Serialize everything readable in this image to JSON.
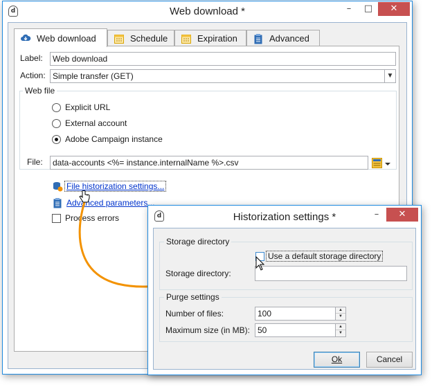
{
  "main_window": {
    "title": "Web download *",
    "app_icon_glyph": "d",
    "minimize": "–",
    "maximize": "□",
    "close": "✕",
    "tabs": [
      {
        "label": "Web download",
        "icon": "cloud-download-icon",
        "active": true
      },
      {
        "label": "Schedule",
        "icon": "calendar-icon",
        "active": false
      },
      {
        "label": "Expiration",
        "icon": "calendar-icon",
        "active": false
      },
      {
        "label": "Advanced",
        "icon": "clipboard-icon",
        "active": false
      }
    ],
    "label_caption": "Label:",
    "label_value": "Web download",
    "action_caption": "Action:",
    "action_value": "Simple transfer (GET)",
    "web_file_group": "Web file",
    "radio_explicit_url": "Explicit URL",
    "radio_external_account": "External account",
    "radio_adobe_instance": "Adobe Campaign instance",
    "selected_radio": "Adobe Campaign instance",
    "file_caption": "File:",
    "file_value": "data-accounts <%= instance.internalName %>.csv",
    "link_historization": "File historization settings...",
    "link_advanced": "Advanced parameters...",
    "process_errors": "Process errors",
    "process_errors_checked": false
  },
  "dialog": {
    "title": "Historization settings *",
    "app_icon_glyph": "d",
    "minimize": "–",
    "close": "✕",
    "storage_group": "Storage directory",
    "use_default_label": "Use a default storage directory",
    "use_default_checked": false,
    "storage_dir_label": "Storage directory:",
    "storage_dir_value": "",
    "purge_group": "Purge settings",
    "num_files_label": "Number of files:",
    "num_files_value": "100",
    "max_size_label": "Maximum size (in MB):",
    "max_size_value": "50",
    "ok_label": "Ok",
    "cancel_label": "Cancel"
  },
  "colors": {
    "window_border": "#1e8ae0",
    "close_button": "#c75050",
    "link": "#0033cc",
    "arrow": "#f39200",
    "icon_yellow": "#f5c342",
    "icon_blue": "#2f6db5"
  }
}
